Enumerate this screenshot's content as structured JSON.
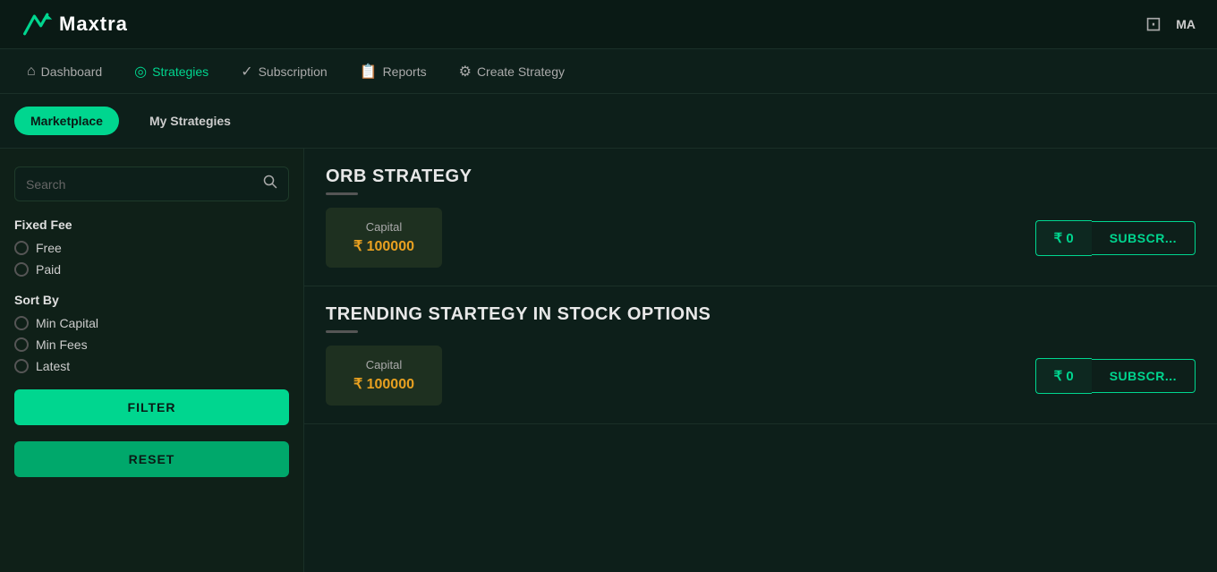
{
  "header": {
    "logo_text": "axtra",
    "user_label": "MA"
  },
  "nav": {
    "items": [
      {
        "id": "dashboard",
        "label": "Dashboard",
        "icon": "⌂",
        "active": false
      },
      {
        "id": "strategies",
        "label": "Strategies",
        "icon": "◎",
        "active": true
      },
      {
        "id": "subscription",
        "label": "Subscription",
        "icon": "✓",
        "active": false
      },
      {
        "id": "reports",
        "label": "Reports",
        "icon": "📄",
        "active": false
      },
      {
        "id": "create-strategy",
        "label": "Create Strategy",
        "icon": "⚙",
        "active": false
      }
    ]
  },
  "sub_nav": {
    "tabs": [
      {
        "id": "marketplace",
        "label": "Marketplace",
        "active": true
      },
      {
        "id": "my-strategies",
        "label": "My Strategies",
        "active": false
      }
    ]
  },
  "sidebar": {
    "search_placeholder": "Search",
    "fixed_fee_label": "Fixed Fee",
    "fixed_fee_options": [
      "Free",
      "Paid"
    ],
    "sort_by_label": "Sort By",
    "sort_by_options": [
      "Min Capital",
      "Min Fees",
      "Latest"
    ],
    "filter_btn": "FILTER",
    "reset_btn": "RESET"
  },
  "strategies": [
    {
      "id": "orb",
      "title": "ORB STRATEGY",
      "capital_label": "Capital",
      "capital_value": "₹ 100000",
      "price": "₹ 0",
      "subscribe_label": "SUBSCR..."
    },
    {
      "id": "trending",
      "title": "TRENDING STARTEGY IN STOCK OPTIONS",
      "capital_label": "Capital",
      "capital_value": "₹ 100000",
      "price": "₹ 0",
      "subscribe_label": "SUBSCR..."
    }
  ]
}
